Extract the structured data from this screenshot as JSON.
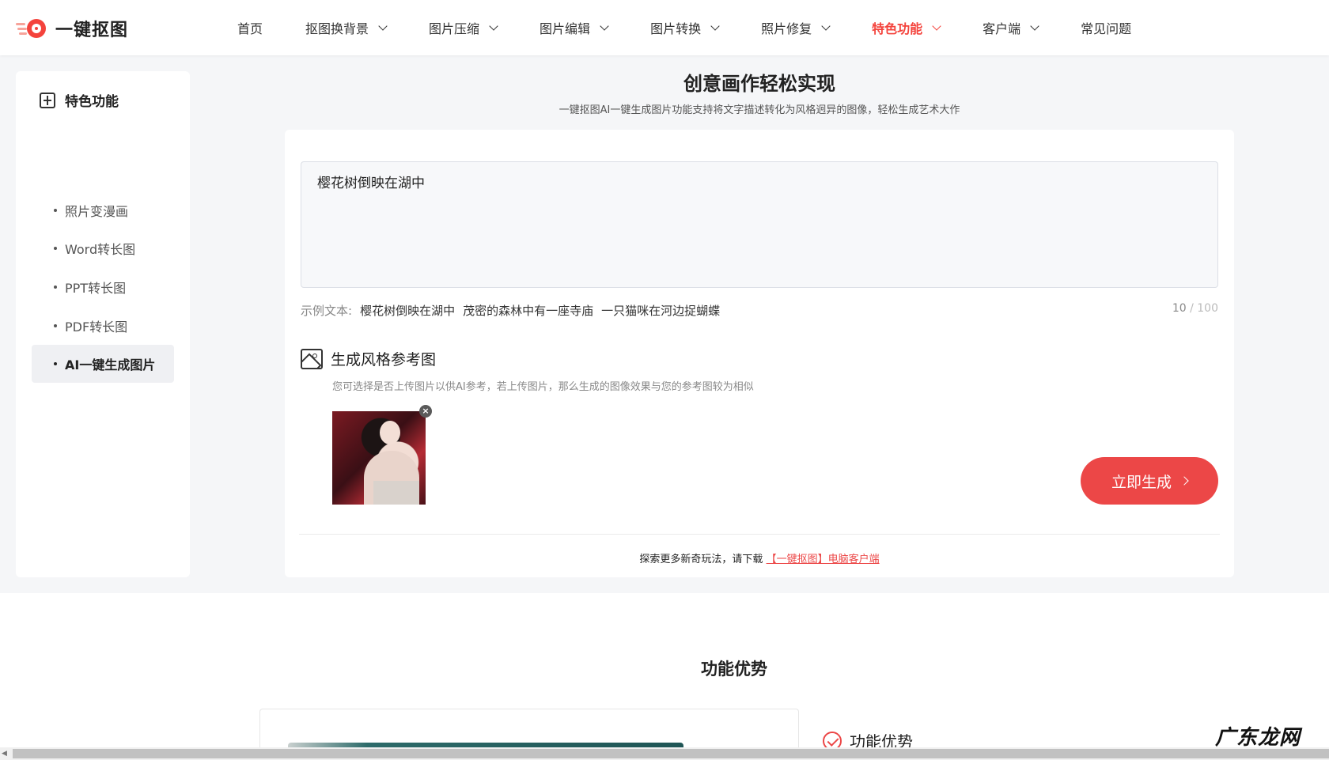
{
  "header": {
    "logo_text": "一键抠图",
    "nav": [
      {
        "label": "首页",
        "dropdown": false,
        "active": false
      },
      {
        "label": "抠图换背景",
        "dropdown": true,
        "active": false
      },
      {
        "label": "图片压缩",
        "dropdown": true,
        "active": false
      },
      {
        "label": "图片编辑",
        "dropdown": true,
        "active": false
      },
      {
        "label": "图片转换",
        "dropdown": true,
        "active": false
      },
      {
        "label": "照片修复",
        "dropdown": true,
        "active": false
      },
      {
        "label": "特色功能",
        "dropdown": true,
        "active": true
      },
      {
        "label": "客户端",
        "dropdown": true,
        "active": false
      },
      {
        "label": "常见问题",
        "dropdown": false,
        "active": false
      }
    ]
  },
  "sidebar": {
    "title": "特色功能",
    "items": [
      {
        "label": "照片变漫画",
        "active": false
      },
      {
        "label": "Word转长图",
        "active": false
      },
      {
        "label": "PPT转长图",
        "active": false
      },
      {
        "label": "PDF转长图",
        "active": false
      },
      {
        "label": "AI一键生成图片",
        "active": true
      }
    ]
  },
  "main": {
    "title": "创意画作轻松实现",
    "subtitle": "一键抠图AI一键生成图片功能支持将文字描述转化为风格迥异的图像，轻松生成艺术大作",
    "prompt_value": "樱花树倒映在湖中",
    "examples_label": "示例文本:",
    "examples": [
      "樱花树倒映在湖中",
      "茂密的森林中有一座寺庙",
      "一只猫咪在河边捉蝴蝶"
    ],
    "char_count": "10",
    "char_max": " / 100",
    "ref_title": "生成风格参考图",
    "ref_desc": "您可选择是否上传图片以供AI参考，若上传图片，那么生成的图像效果与您的参考图较为相似",
    "close_label": "×",
    "generate_label": "立即生成",
    "footer_prefix": "探索更多新奇玩法，请下载",
    "footer_link": "【一键抠图】电脑客户端"
  },
  "advantages": {
    "title": "功能优势",
    "item_label": "功能优势",
    "watermark": "广东龙网"
  },
  "colors": {
    "accent": "#ec4747",
    "brand": "#f4433c"
  },
  "icons": {
    "sidebar_head": "feature-icon",
    "ref": "image-icon",
    "check": "check-circle-icon"
  }
}
